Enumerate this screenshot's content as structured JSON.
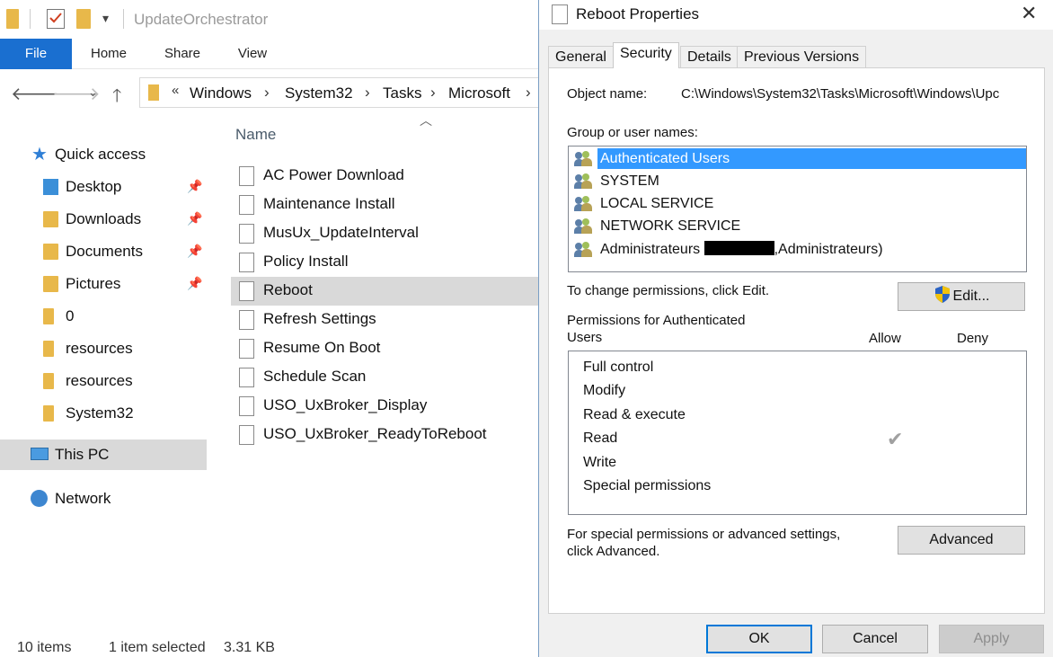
{
  "explorer": {
    "window_title": "UpdateOrchestrator",
    "ribbon_tabs": [
      "File",
      "Home",
      "Share",
      "View"
    ],
    "breadcrumb_prefix": "«",
    "breadcrumb": [
      "Windows",
      "System32",
      "Tasks",
      "Microsoft"
    ],
    "column_header": "Name",
    "nav": {
      "quick_access": "Quick access",
      "pinned": [
        "Desktop",
        "Downloads",
        "Documents",
        "Pictures"
      ],
      "folders": [
        "0",
        "resources",
        "resources",
        "System32"
      ],
      "this_pc": "This PC",
      "network": "Network"
    },
    "files": [
      "AC Power Download",
      "Maintenance Install",
      "MusUx_UpdateInterval",
      "Policy Install",
      "Reboot",
      "Refresh Settings",
      "Resume On Boot",
      "Schedule Scan",
      "USO_UxBroker_Display",
      "USO_UxBroker_ReadyToReboot"
    ],
    "selected_file": "Reboot",
    "status": {
      "item_count": "10 items",
      "selection": "1 item selected",
      "size": "3.31 KB"
    }
  },
  "dialog": {
    "title": "Reboot Properties",
    "tabs": [
      "General",
      "Security",
      "Details",
      "Previous Versions"
    ],
    "active_tab": "Security",
    "object_name_label": "Object name:",
    "object_name_value": "C:\\Windows\\System32\\Tasks\\Microsoft\\Windows\\Upc",
    "group_label": "Group or user names:",
    "users": [
      "Authenticated Users",
      "SYSTEM",
      "LOCAL SERVICE",
      "NETWORK SERVICE"
    ],
    "admin_user_prefix": "Administrateurs",
    "admin_user_suffix": ",Administrateurs)",
    "change_perm_text": "To change permissions, click Edit.",
    "edit_button": "Edit...",
    "perm_for_line1": "Permissions for Authenticated",
    "perm_for_line2": "Users",
    "allow_header": "Allow",
    "deny_header": "Deny",
    "permissions": [
      {
        "name": "Full control",
        "allow": false
      },
      {
        "name": "Modify",
        "allow": false
      },
      {
        "name": "Read & execute",
        "allow": false
      },
      {
        "name": "Read",
        "allow": true
      },
      {
        "name": "Write",
        "allow": false
      },
      {
        "name": "Special permissions",
        "allow": false
      }
    ],
    "check_glyph": "✔",
    "advanced_text_line1": "For special permissions or advanced settings,",
    "advanced_text_line2": "click Advanced.",
    "advanced_button": "Advanced",
    "ok_button": "OK",
    "cancel_button": "Cancel",
    "apply_button": "Apply"
  }
}
